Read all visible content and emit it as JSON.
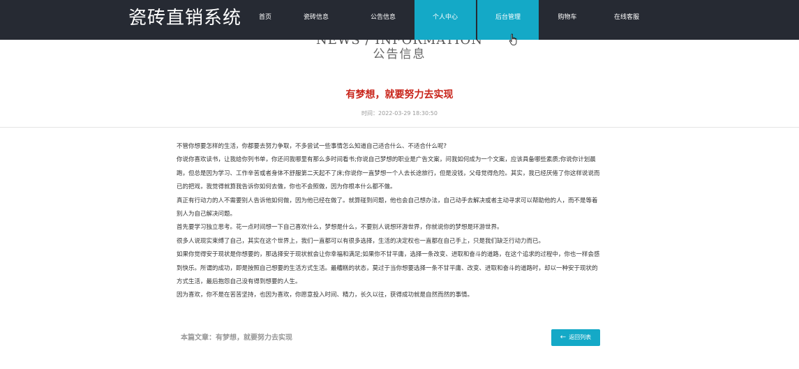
{
  "header": {
    "brand": "瓷砖直销系统",
    "nav": [
      {
        "label": "首页"
      },
      {
        "label": "瓷砖信息"
      },
      {
        "label": "公告信息"
      },
      {
        "label": "个人中心"
      },
      {
        "label": "后台管理"
      },
      {
        "label": "购物车"
      },
      {
        "label": "在线客服"
      }
    ],
    "accent_color": "#14a9c7"
  },
  "section": {
    "title_en": "NEWS / INFORMATION",
    "title_zh": "公告信息"
  },
  "article": {
    "title": "有梦想，就要努力去实现",
    "time": "时间：2022-03-29 18:30:50",
    "paragraphs": [
      "不管你想要怎样的生活，你都要去努力争取，不多尝试一些事情怎么知道自己适合什么、不适合什么呢?",
      "你说你喜欢读书，让我给你列书单，你还问我哪里有那么多时间看书;你说自己梦想的职业是广告文案，问我如何成为一个文案，应该具备哪些素质;你说你计划晨跑，但总是因为学习、工作辛苦或者身体不舒服第二天起不了床;你说你一直梦想一个人去长途旅行，但是没钱，父母觉得危险。其实，我已经厌倦了你这样说说而已的把戏，我觉得就算我告诉你如何去做，你也不会照做，因为你根本什么都不做。",
      "真正有行动力的人不需要别人告诉他如何做，因为他已经在做了。就算碰到问题，他也会自己想办法，自己动手去解决或者主动寻求可以帮助他的人，而不是等着别人为自己解决问题。",
      "首先要学习独立思考。花一点时间想一下自己喜欢什么，梦想是什么，不要别人说想环游世界，你就说你的梦想是环游世界。",
      "很多人说现实束缚了自己，其实在这个世界上，我们一直都可以有很多选择，生活的决定权也一直都在自己手上，只是我们缺乏行动力而已。",
      "如果你觉得安于现状是你想要的，那选择安于现状就会让你幸福和满足;如果你不甘平庸，选择一条改变、进取和奋斗的道路，在这个追求的过程中，你也一样会感到快乐。所谓的成功，即是按照自己想要的生活方式生活。最糟糕的状态，莫过于当你想要选择一条不甘平庸、改变、进取和奋斗的道路时，却以一种安于现状的方式生活，最后抱怨自己没有得到想要的人生。",
      "因为喜欢，你不是在苦苦坚持，也因为喜欢，你愿意投入时间、精力，长久以往，获得成功就是自然而然的事情。"
    ],
    "footer_label": "本篇文章：有梦想，就要努力去实现",
    "back_label": "返回列表"
  }
}
